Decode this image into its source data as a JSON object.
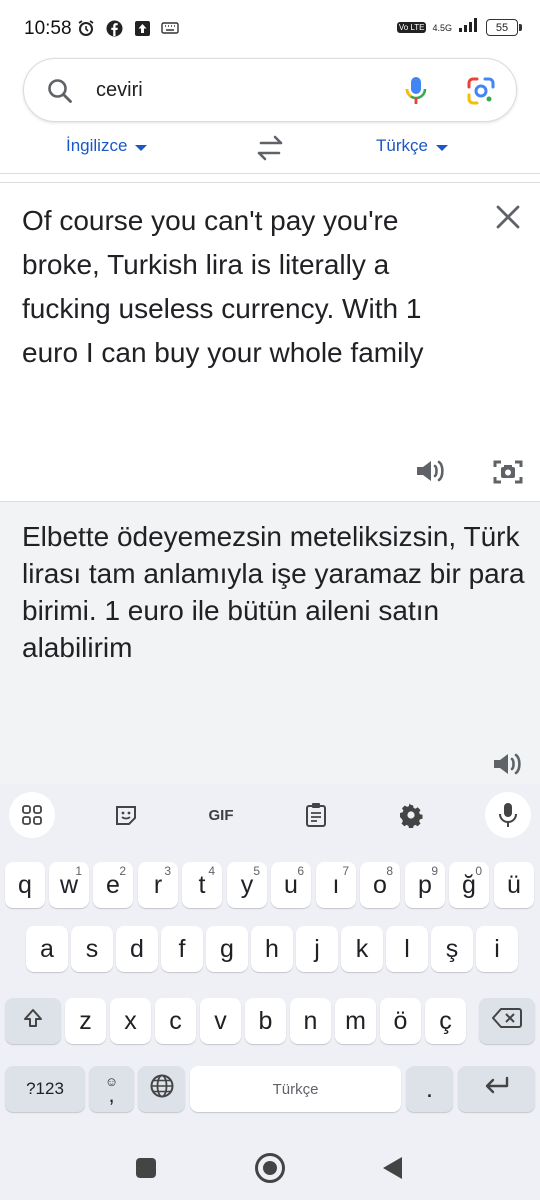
{
  "status_bar": {
    "time": "10:58",
    "network": "4.5G",
    "volte": "Vo LTE",
    "battery": "55",
    "icons": [
      "alarm-icon",
      "facebook-icon",
      "upload-icon",
      "keyboard-icon"
    ]
  },
  "search": {
    "query": "ceviri"
  },
  "languages": {
    "source": "İngilizce",
    "target": "Türkçe"
  },
  "source_text": "Of course you can't pay you're broke, Turkish lira is literally a fucking useless currency.  With 1 euro I can buy your whole family",
  "translation_text": "Elbette ödeyemezsin meteliksizsin, Türk lirası tam anlamıyla işe yaramaz bir para birimi. 1 euro ile bütün aileni satın alabilirim",
  "keyboard": {
    "toolbar": {
      "gif_label": "GIF"
    },
    "row1": [
      {
        "k": "q",
        "h": ""
      },
      {
        "k": "w",
        "h": "1"
      },
      {
        "k": "e",
        "h": "2"
      },
      {
        "k": "r",
        "h": "3"
      },
      {
        "k": "t",
        "h": "4"
      },
      {
        "k": "y",
        "h": "5"
      },
      {
        "k": "u",
        "h": "6"
      },
      {
        "k": "ı",
        "h": "7"
      },
      {
        "k": "o",
        "h": "8"
      },
      {
        "k": "p",
        "h": "9"
      },
      {
        "k": "ğ",
        "h": "0"
      },
      {
        "k": "ü",
        "h": ""
      }
    ],
    "row2": [
      "a",
      "s",
      "d",
      "f",
      "g",
      "h",
      "j",
      "k",
      "l",
      "ş",
      "i"
    ],
    "row3": [
      "z",
      "x",
      "c",
      "v",
      "b",
      "n",
      "m",
      "ö",
      "ç"
    ],
    "symbols_label": "?123",
    "emoji_comma": ",",
    "space_label": "Türkçe",
    "period": "."
  },
  "colors": {
    "accent_blue": "#1a57c8",
    "keyboard_bg": "#eef0f6",
    "result_bg": "#f1f3f4"
  }
}
